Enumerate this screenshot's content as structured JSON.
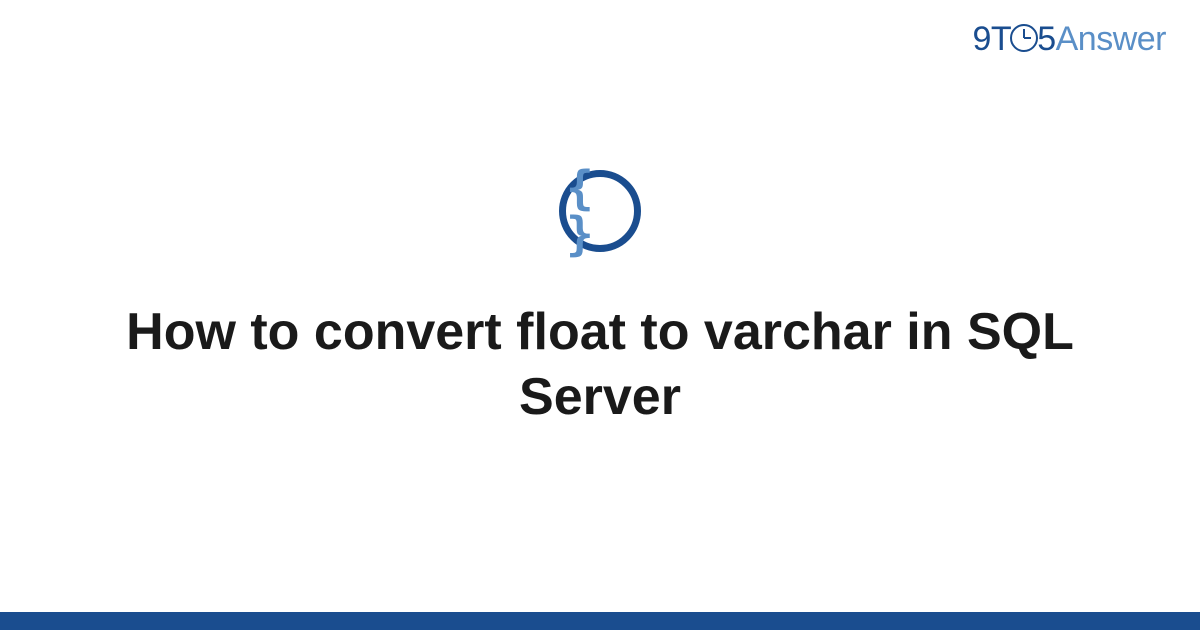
{
  "logo": {
    "part1": "9T",
    "part2": "5",
    "part3": "Answer"
  },
  "icon": {
    "braces": "{ }",
    "name": "code-braces-icon"
  },
  "question": {
    "title": "How to convert float to varchar in SQL Server"
  },
  "colors": {
    "primary": "#1a4d8f",
    "secondary": "#5a8fc7",
    "text": "#1a1a1a"
  }
}
